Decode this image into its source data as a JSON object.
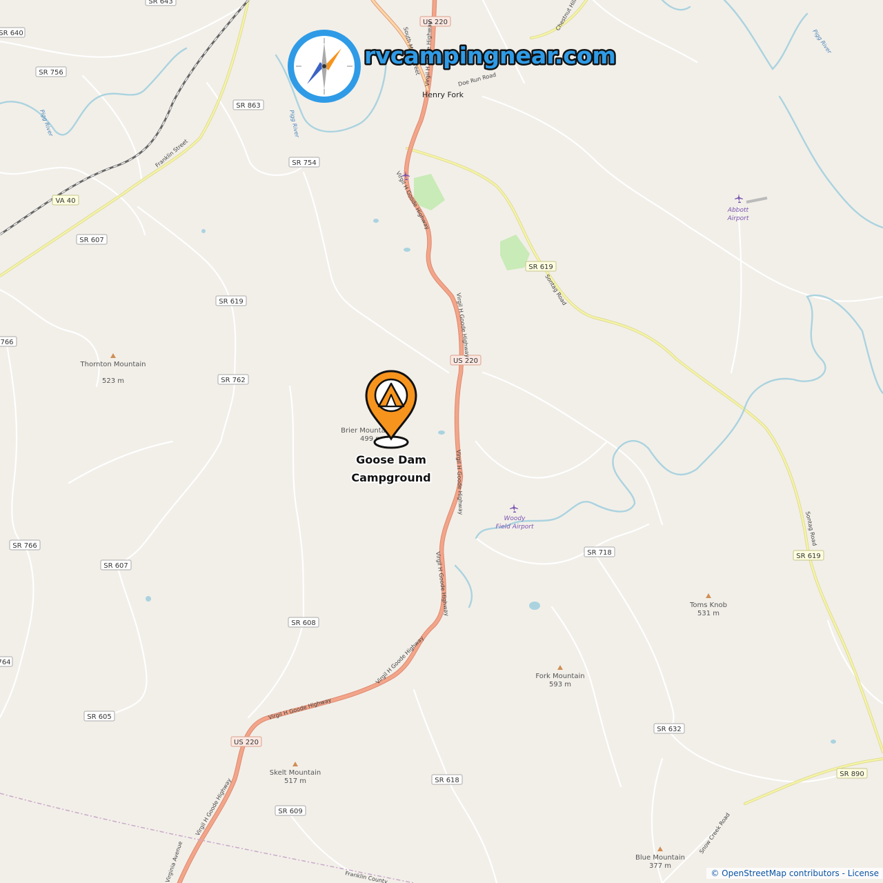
{
  "brand": {
    "name": "rvcampingnear.com"
  },
  "campground": {
    "name_line1": "Goose Dam",
    "name_line2": "Campground"
  },
  "shields": [
    "SR 643",
    "SR 640",
    "SR 756",
    "SR 863",
    "US 220",
    "SR 754",
    "VA 40",
    "SR 607",
    "SR 619",
    "SR 619",
    "766",
    "SR 762",
    "US 220",
    "SR 766",
    "SR 607",
    "SR 718",
    "SR 619",
    "SR 608",
    "764",
    "SR 605",
    "US 220",
    "SR 632",
    "SR 618",
    "SR 609",
    "SR 890"
  ],
  "road_names": [
    "South Main Street",
    "Virgil H Goode Highway",
    "Doe Run Road",
    "Chestnut Hill Road",
    "Franklin Street",
    "Virgil H Goode Highway",
    "Sontag Road",
    "Virgil H Goode Highway",
    "Virgil H Goode Highway",
    "Virgil H Goode Highway",
    "Virgil H Goode Highway",
    "Virgil H Goode Highway",
    "Virgil H Goode Highway",
    "Sontag Road",
    "Snow Creek Road",
    "Virginia Avenue",
    "Franklin County"
  ],
  "towns": [
    "Henry Fork"
  ],
  "rivers": [
    "Pigg River",
    "Pigg River",
    "Pigg River"
  ],
  "peaks": [
    {
      "name": "Thornton Mountain",
      "elev": "523 m"
    },
    {
      "name": "Brier Mountain",
      "elev": "499 m"
    },
    {
      "name": "Toms Knob",
      "elev": "531 m"
    },
    {
      "name": "Fork Mountain",
      "elev": "593 m"
    },
    {
      "name": "Skelt Mountain",
      "elev": "517 m"
    },
    {
      "name": "Blue Mountain",
      "elev": "377 m"
    }
  ],
  "airports": [
    {
      "line1": "Abbott",
      "line2": "Airport"
    },
    {
      "line1": "Woody",
      "line2": "Field Airport"
    }
  ],
  "attribution": "© OpenStreetMap contributors - License",
  "colors": {
    "primary_road": "#f3a58a",
    "secondary_road": "#f5f4a6",
    "water": "#aad3df",
    "park": "#c9ebb7",
    "marker": "#f7941d",
    "brand": "#2f9be6"
  }
}
